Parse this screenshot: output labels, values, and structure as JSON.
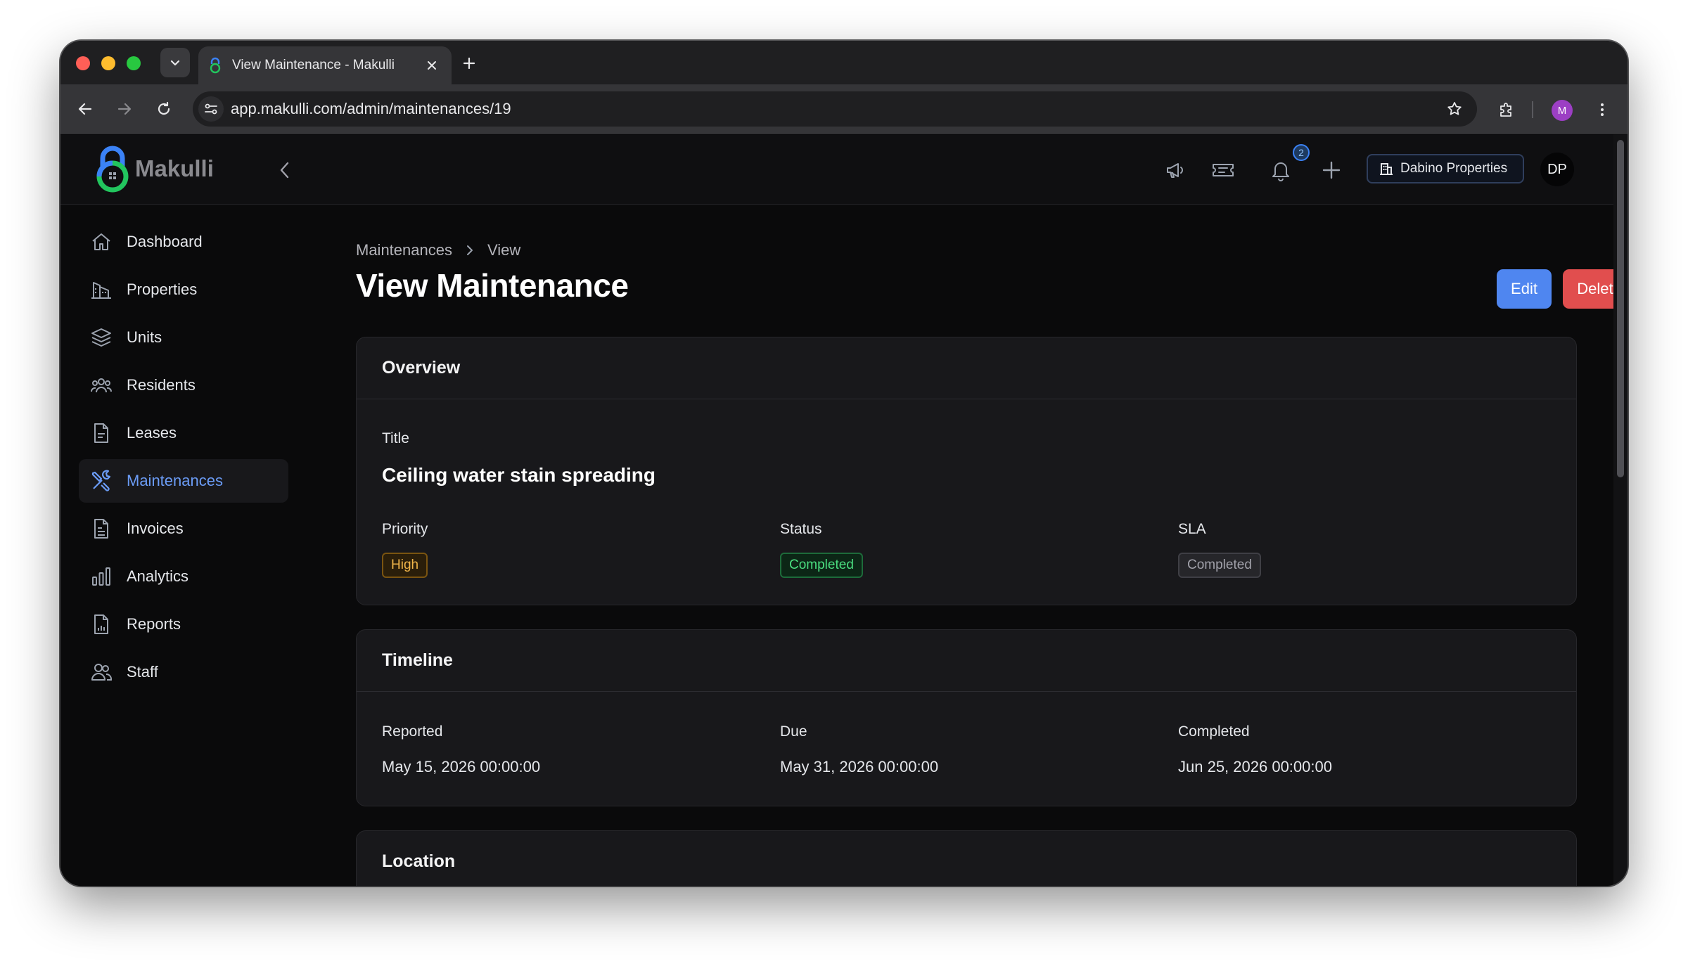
{
  "browser": {
    "tab_title": "View Maintenance - Makulli",
    "url": "app.makulli.com/admin/maintenances/19",
    "profile_initial": "M"
  },
  "header": {
    "logo_text": "Makulli",
    "notification_count": "2",
    "organization": "Dabino Properties",
    "avatar_initials": "DP"
  },
  "sidebar": {
    "items": [
      {
        "label": "Dashboard",
        "icon": "home-icon"
      },
      {
        "label": "Properties",
        "icon": "building-icon"
      },
      {
        "label": "Units",
        "icon": "layers-icon"
      },
      {
        "label": "Residents",
        "icon": "users-icon"
      },
      {
        "label": "Leases",
        "icon": "document-icon"
      },
      {
        "label": "Maintenances",
        "icon": "tools-icon",
        "active": true
      },
      {
        "label": "Invoices",
        "icon": "invoice-icon"
      },
      {
        "label": "Analytics",
        "icon": "bar-chart-icon"
      },
      {
        "label": "Reports",
        "icon": "report-icon"
      },
      {
        "label": "Staff",
        "icon": "staff-icon"
      }
    ]
  },
  "breadcrumb": {
    "parent": "Maintenances",
    "current": "View"
  },
  "page": {
    "title": "View Maintenance",
    "edit_label": "Edit",
    "delete_label": "Delete"
  },
  "overview": {
    "heading": "Overview",
    "title_label": "Title",
    "title_value": "Ceiling water stain spreading",
    "priority_label": "Priority",
    "priority_value": "High",
    "status_label": "Status",
    "status_value": "Completed",
    "sla_label": "SLA",
    "sla_value": "Completed"
  },
  "timeline": {
    "heading": "Timeline",
    "reported_label": "Reported",
    "reported_value": "May 15, 2026 00:00:00",
    "due_label": "Due",
    "due_value": "May 31, 2026 00:00:00",
    "completed_label": "Completed",
    "completed_value": "Jun 25, 2026 00:00:00"
  },
  "location": {
    "heading": "Location"
  },
  "colors": {
    "accent": "#4f86f0",
    "danger": "#e14e4e",
    "success": "#4ade80",
    "warning": "#f0b54a",
    "active_nav": "#6b9cf6"
  }
}
